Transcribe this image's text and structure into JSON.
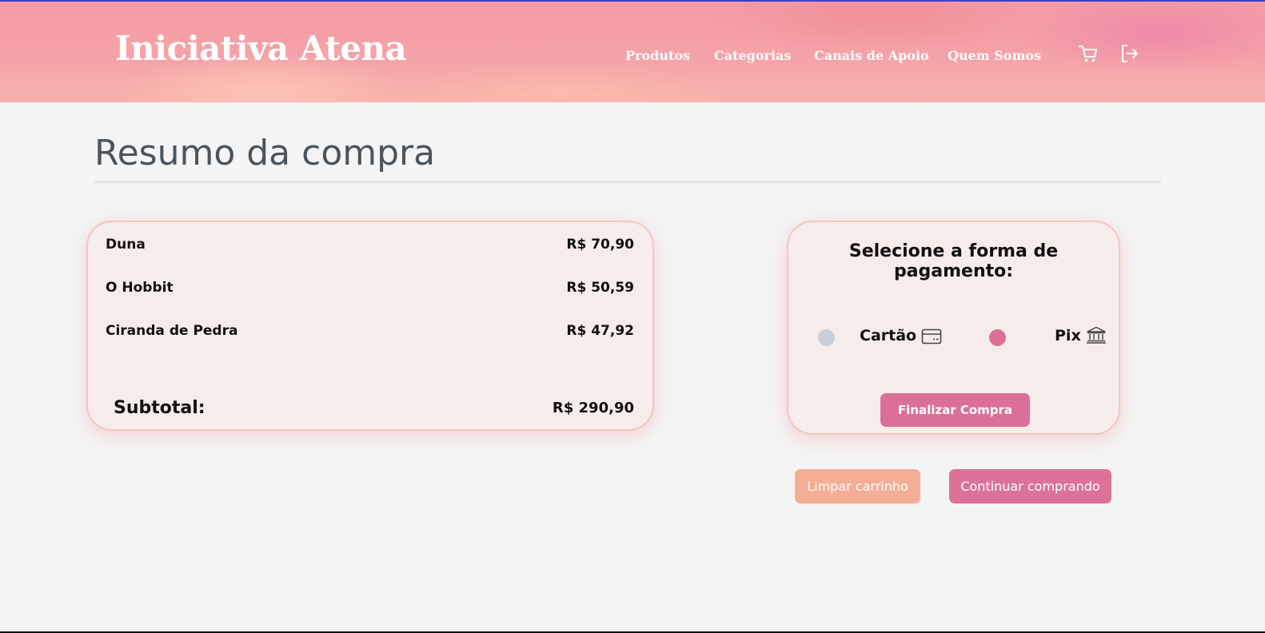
{
  "header": {
    "logo": "Iniciativa Atena",
    "nav": [
      "Produtos",
      "Categorias",
      "Canais de Apoio",
      "Quem Somos"
    ],
    "icons": [
      "cart-icon",
      "logout-icon"
    ]
  },
  "main": {
    "title": "Resumo da compra"
  },
  "cart": {
    "items": [
      {
        "name": "Duna",
        "price": "R$ 70,90"
      },
      {
        "name": "O Hobbit",
        "price": "R$ 50,59"
      },
      {
        "name": "Ciranda de Pedra",
        "price": "R$ 47,92"
      }
    ],
    "subtotal_label": "Subtotal:",
    "subtotal_value": "R$ 290,90"
  },
  "payment": {
    "title": "Selecione a forma de pagamento:",
    "options": [
      {
        "label": "Cartão",
        "icon": "credit-card-icon",
        "selected": false
      },
      {
        "label": "Pix",
        "icon": "bank-icon",
        "selected": true
      }
    ],
    "finish_label": "Finalizar Compra"
  },
  "actions": {
    "clear_label": "Limpar carrinho",
    "continue_label": "Continuar comprando"
  },
  "colors": {
    "accent_pink": "#dc6f98",
    "accent_peach": "#f6ad96",
    "card_bg": "#f6ece9",
    "radio_off": "#c8cfd8"
  }
}
